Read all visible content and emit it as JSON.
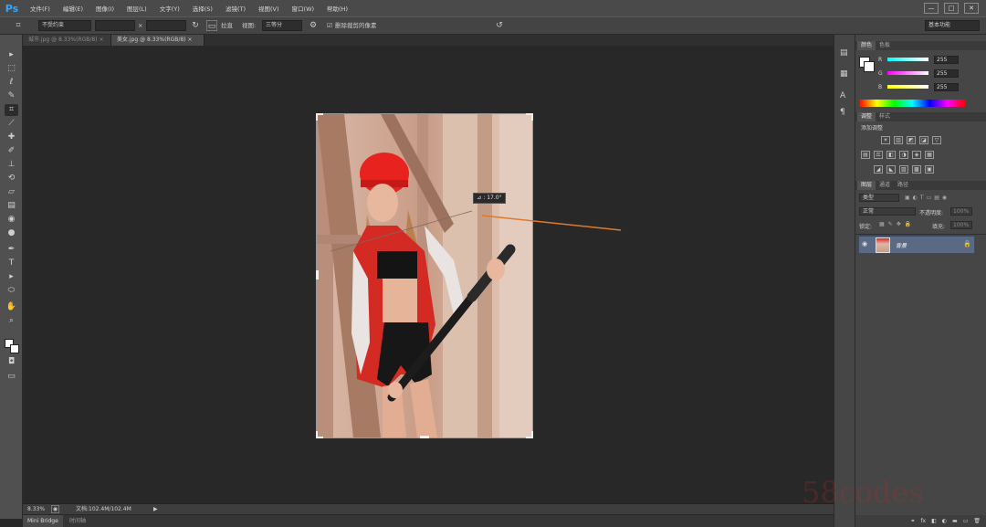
{
  "app": {
    "logo": "Ps"
  },
  "menu": [
    "文件(F)",
    "编辑(E)",
    "图像(I)",
    "图层(L)",
    "文字(Y)",
    "选择(S)",
    "滤镜(T)",
    "视图(V)",
    "窗口(W)",
    "帮助(H)"
  ],
  "window_controls": [
    "—",
    "□",
    "✕"
  ],
  "options_bar": {
    "ratio_select": "不受约束",
    "width_value": "",
    "height_value": "",
    "straighten_label": "拉直",
    "view_label": "视图:",
    "view_select": "三等分",
    "delete_pixels_label": "删除裁剪的像素",
    "workspace_select": "基本功能"
  },
  "document_tabs": [
    {
      "label": "城市.jpg @ 8.33%(RGB/8)",
      "close": "×",
      "active": false
    },
    {
      "label": "美女.jpg @ 8.33%(RGB/8)",
      "close": "×",
      "active": true
    }
  ],
  "canvas": {
    "angle_tooltip": "⊿ : 17.0°"
  },
  "status": {
    "zoom": "8.33%",
    "doc_info": "文档:102.4M/102.4M",
    "arrow": "▶"
  },
  "bottom_tabs": [
    "Mini Bridge",
    "时间轴"
  ],
  "color_panel": {
    "tabs": [
      "颜色",
      "色板"
    ],
    "channels": [
      {
        "label": "R",
        "value": "255",
        "color": "#ff3a3a"
      },
      {
        "label": "G",
        "value": "255",
        "color": "#3aff3a"
      },
      {
        "label": "B",
        "value": "255",
        "color": "#3a7aff"
      }
    ]
  },
  "adjust_panel": {
    "tabs": [
      "调整",
      "样式"
    ],
    "title": "添加调整",
    "row1": [
      "☀",
      "▥",
      "◩",
      "◪",
      "▽"
    ],
    "row2": [
      "▤",
      "⚖",
      "◧",
      "◑",
      "◈",
      "▦"
    ],
    "row3": [
      "◢",
      "◣",
      "▨",
      "▩",
      "▣"
    ]
  },
  "layers_panel": {
    "tabs": [
      "图层",
      "通道",
      "路径"
    ],
    "kind_select": "类型",
    "blend_select": "正常",
    "opacity_label": "不透明度:",
    "opacity_value": "100%",
    "lock_label": "锁定:",
    "fill_label": "填充:",
    "fill_value": "100%",
    "layer_name": "背景",
    "bottom_icons": [
      "⚭",
      "fx",
      "◧",
      "◐",
      "▬",
      "▭",
      "🗑"
    ]
  },
  "watermark": "58codes",
  "colors": {
    "ps_blue": "#31a8ff",
    "selected_layer": "#5a6a85",
    "crop_handle_line": "#e07a2a"
  }
}
